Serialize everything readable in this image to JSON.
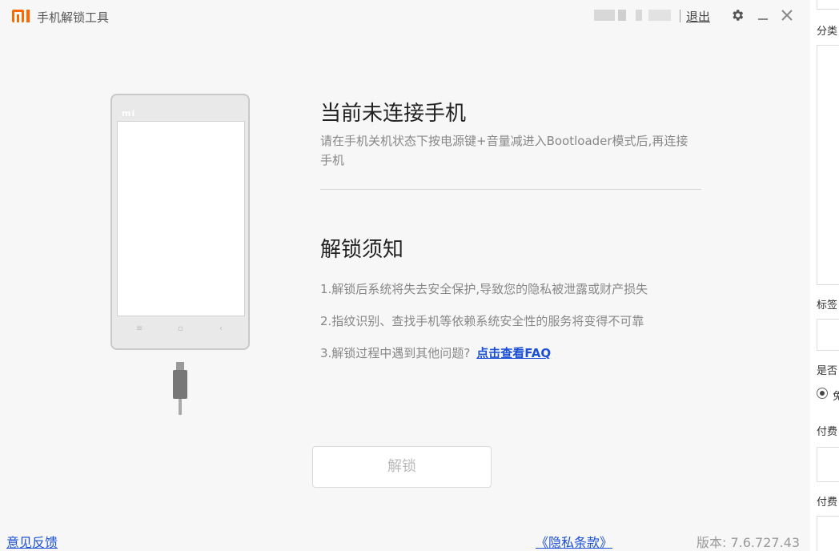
{
  "titlebar": {
    "logo_text": "mi",
    "app_title": "手机解锁工具",
    "logout_label": "退出",
    "accent_color": "#ff6700"
  },
  "icons": [
    "mi-logo-icon",
    "gear-icon",
    "minimize-icon",
    "close-icon",
    "phone-icon",
    "usb-cable-icon"
  ],
  "phone": {
    "logo": "mi",
    "keys": [
      "≡",
      "▫",
      "‹"
    ]
  },
  "main": {
    "heading": "当前未连接手机",
    "hint": "请在手机关机状态下按电源键+音量减进入Bootloader模式后,再连接手机",
    "notice_heading": "解锁须知",
    "notices": [
      "1.解锁后系统将失去安全保护,导致您的隐私被泄露或财产损失",
      "2.指纹识别、查找手机等依赖系统安全性的服务将变得不可靠",
      "3.解锁过程中遇到其他问题?"
    ],
    "faq_link": "点击查看FAQ",
    "unlock_button": "解锁"
  },
  "footer": {
    "feedback": "意见反馈",
    "privacy": "《隐私条款》",
    "version": "版本: 7.6.727.43",
    "link_color": "#1a4fd6"
  },
  "side_panel": {
    "labels": [
      "分类",
      "标签",
      "是否",
      "付费",
      "付费"
    ],
    "radio_text": "免"
  }
}
